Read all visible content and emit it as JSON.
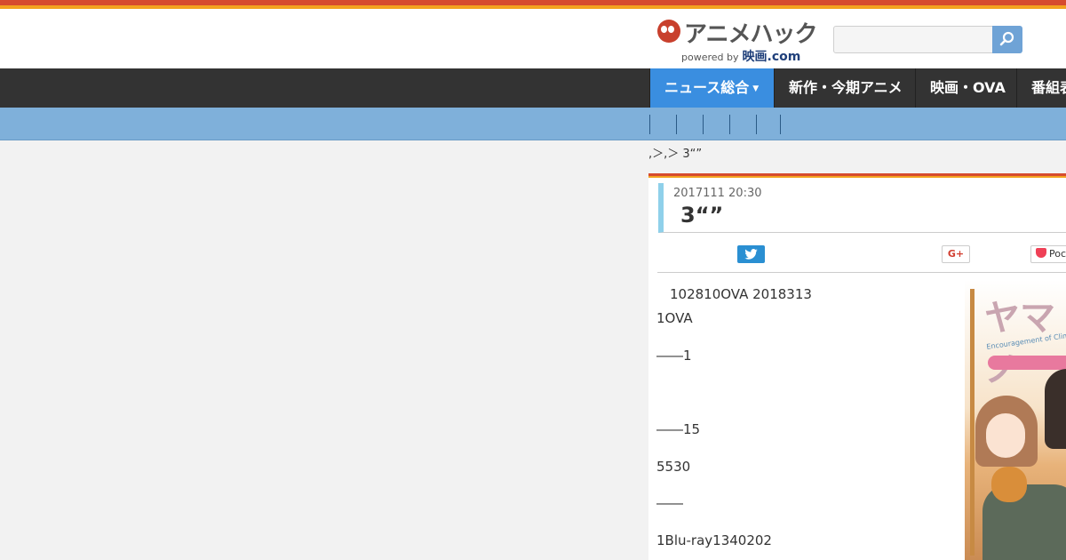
{
  "header": {
    "logo_text": "アニメハック",
    "logo_powered": "powered by",
    "logo_brand": "映画.com",
    "search_placeholder": ""
  },
  "nav": {
    "items": [
      {
        "label": "ニュース総合",
        "active": true
      },
      {
        "label": "新作・今期アニメ",
        "active": false
      },
      {
        "label": "映画・OVA",
        "active": false
      },
      {
        "label": "番組表",
        "active": false
      }
    ]
  },
  "breadcrumb": ",＞,＞ 3“”",
  "article": {
    "date": "2017111 20:30",
    "title": "3“”",
    "share": {
      "gplus": "G+",
      "pocket": "Pocket"
    },
    "paragraphs": [
      "102810OVA 2018313",
      "1OVA",
      "――1",
      "――15",
      "5530",
      "――",
      "1Blu-ray1340202"
    ]
  },
  "colors": {
    "accent_red": "#d64b2e",
    "accent_orange": "#f3a21f",
    "nav_bg": "#333333",
    "nav_active": "#3a8ee0",
    "subnav_bg": "#7fb0da",
    "title_bar": "#8fd0ea",
    "twitter": "#2a8fd2"
  }
}
